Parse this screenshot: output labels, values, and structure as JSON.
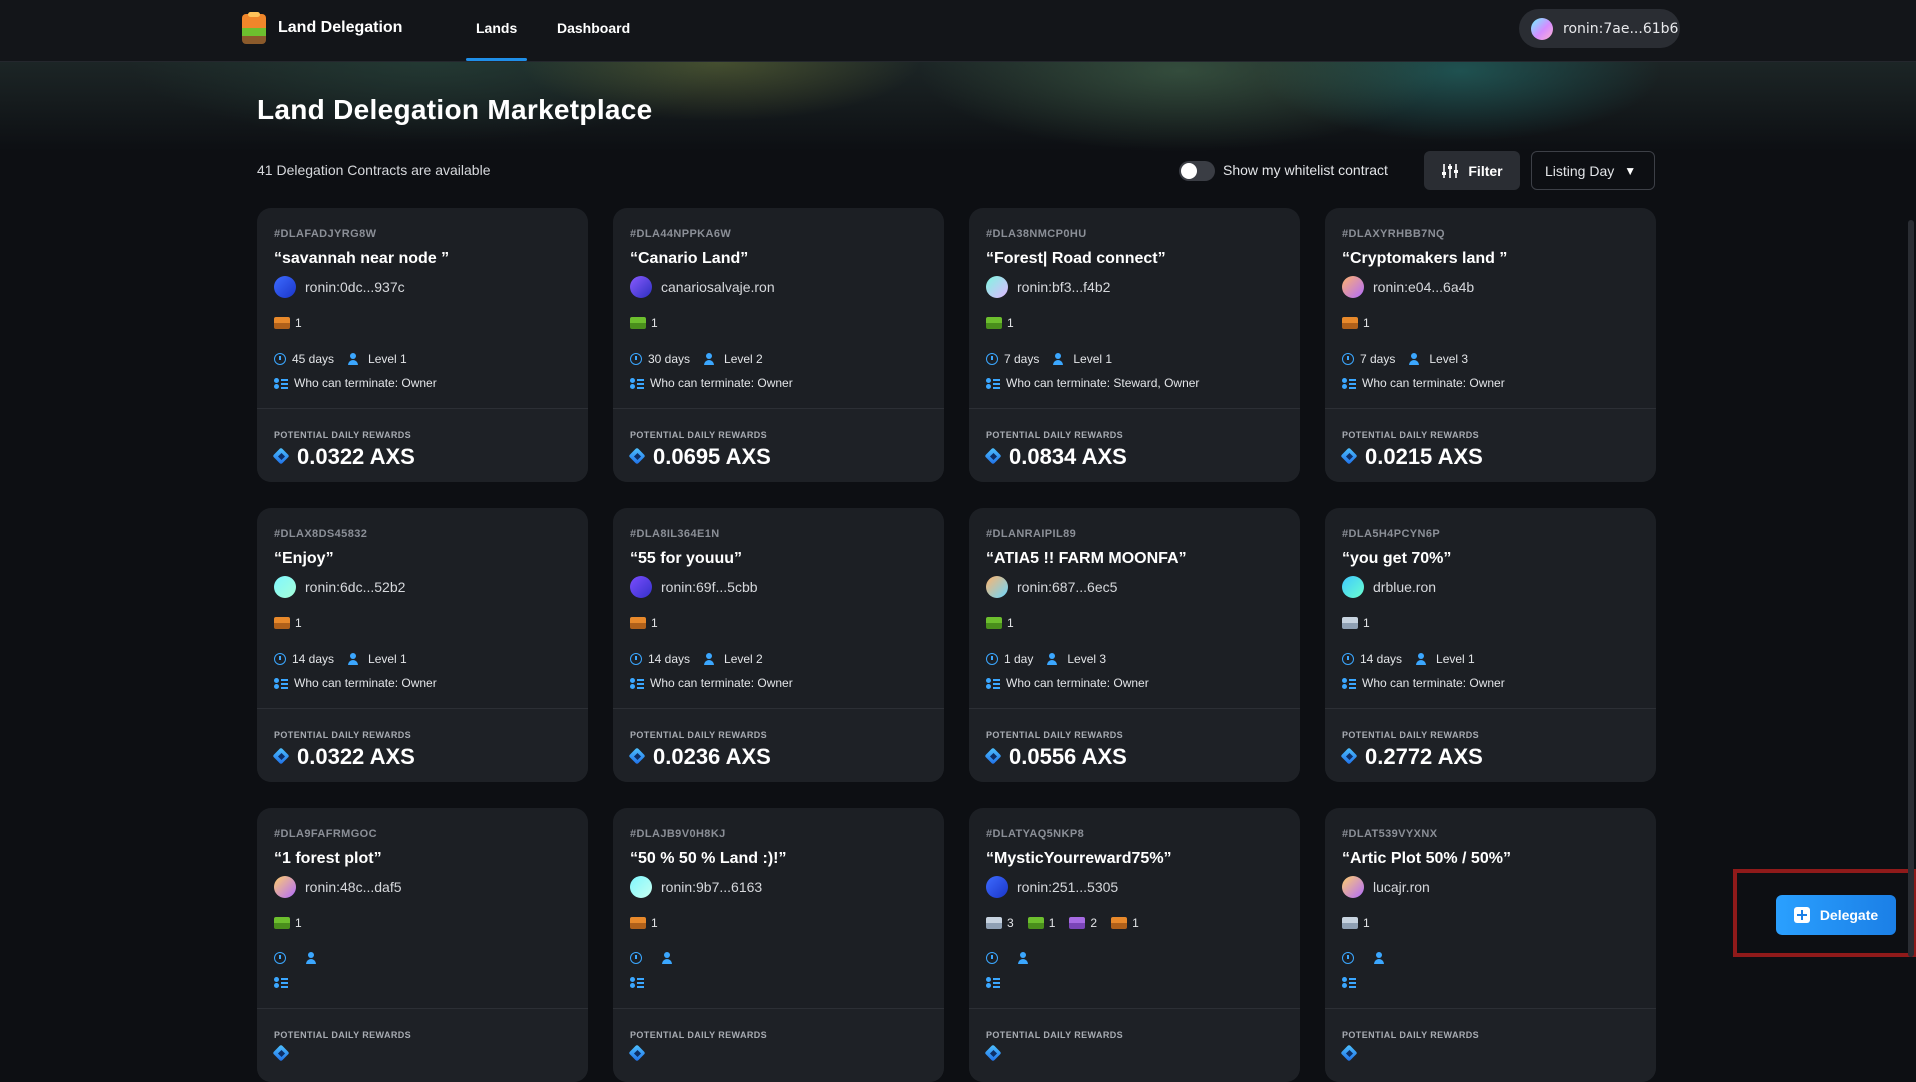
{
  "nav": {
    "brand": "Land Delegation",
    "tabs": [
      {
        "label": "Lands",
        "active": true
      },
      {
        "label": "Dashboard",
        "active": false
      }
    ],
    "wallet_address": "ronin:7ae...61b6"
  },
  "page": {
    "title": "Land Delegation Marketplace",
    "available_text": "41 Delegation Contracts are available"
  },
  "toolbar": {
    "whitelist_toggle_label": "Show my whitelist contract",
    "whitelist_toggle_on": false,
    "filter_label": "Filter",
    "sort_label": "Listing Day"
  },
  "reward_label": "POTENTIAL DAILY REWARDS",
  "terminate_prefix": "Who can terminate: ",
  "colors": {
    "accent": "#1f8fe8",
    "savannah": "#e8892b",
    "forest": "#6dbf2e",
    "arctic": "#c7d3e0",
    "mystic": "#a76be3"
  },
  "cards": [
    {
      "id": "#DLAFADJYRG8W",
      "name": "“savannah near node ”",
      "owner": "ronin:0dc...937c",
      "avatar": [
        "#3d6bff",
        "#1a35c9"
      ],
      "plots": [
        {
          "type": "savannah",
          "count": "1"
        }
      ],
      "duration": "45 days",
      "level": "Level 1",
      "terminate": "Who can terminate: Owner",
      "reward": "0.0322 AXS"
    },
    {
      "id": "#DLA44NPPKA6W",
      "name": "“Canario Land”",
      "owner": "canariosalvaje.ron",
      "avatar": [
        "#8a5bff",
        "#2c2fbf"
      ],
      "plots": [
        {
          "type": "forest",
          "count": "1"
        }
      ],
      "duration": "30 days",
      "level": "Level 2",
      "terminate": "Who can terminate: Owner",
      "reward": "0.0695 AXS"
    },
    {
      "id": "#DLA38NMCP0HU",
      "name": "“Forest| Road connect”",
      "owner": "ronin:bf3...f4b2",
      "avatar": [
        "#7ff7e0",
        "#e0b6ff"
      ],
      "plots": [
        {
          "type": "forest",
          "count": "1"
        }
      ],
      "duration": "7 days",
      "level": "Level 1",
      "terminate": "Who can terminate: Steward, Owner",
      "reward": "0.0834 AXS"
    },
    {
      "id": "#DLAXYRHBB7NQ",
      "name": "“Cryptomakers land ”",
      "owner": "ronin:e04...6a4b",
      "avatar": [
        "#ffb36b",
        "#b06bff"
      ],
      "plots": [
        {
          "type": "savannah",
          "count": "1"
        }
      ],
      "duration": "7 days",
      "level": "Level 3",
      "terminate": "Who can terminate: Owner",
      "reward": "0.0215 AXS"
    },
    {
      "id": "#DLAX8DS45832",
      "name": "“Enjoy”",
      "owner": "ronin:6dc...52b2",
      "avatar": [
        "#7ff7ff",
        "#a7ffd8"
      ],
      "plots": [
        {
          "type": "savannah",
          "count": "1"
        }
      ],
      "duration": "14 days",
      "level": "Level 1",
      "terminate": "Who can terminate: Owner",
      "reward": "0.0322 AXS"
    },
    {
      "id": "#DLA8IL364E1N",
      "name": "“55 for youuu”",
      "owner": "ronin:69f...5cbb",
      "avatar": [
        "#7b4dff",
        "#3431c9"
      ],
      "plots": [
        {
          "type": "savannah",
          "count": "1"
        }
      ],
      "duration": "14 days",
      "level": "Level 2",
      "terminate": "Who can terminate: Owner",
      "reward": "0.0236 AXS"
    },
    {
      "id": "#DLANRAIPIL89",
      "name": "“ATIA5 !! FARM MOONFA”",
      "owner": "ronin:687...6ec5",
      "avatar": [
        "#ffb36b",
        "#6bd7ff"
      ],
      "plots": [
        {
          "type": "forest",
          "count": "1"
        }
      ],
      "duration": "1 day",
      "level": "Level 3",
      "terminate": "Who can terminate: Owner",
      "reward": "0.0556 AXS"
    },
    {
      "id": "#DLA5H4PCYN6P",
      "name": "“you get 70%”",
      "owner": "drblue.ron",
      "avatar": [
        "#3fc9ff",
        "#6bffcf"
      ],
      "plots": [
        {
          "type": "arctic",
          "count": "1"
        }
      ],
      "duration": "14 days",
      "level": "Level 1",
      "terminate": "Who can terminate: Owner",
      "reward": "0.2772 AXS"
    },
    {
      "id": "#DLA9FAFRMGOC",
      "name": "“1 forest plot”",
      "owner": "ronin:48c...daf5",
      "avatar": [
        "#ffcf6b",
        "#b06bff"
      ],
      "plots": [
        {
          "type": "forest",
          "count": "1"
        }
      ],
      "duration": "",
      "level": "",
      "terminate": "",
      "reward": ""
    },
    {
      "id": "#DLAJB9V0H8KJ",
      "name": "“50 % 50 % Land :)!”",
      "owner": "ronin:9b7...6163",
      "avatar": [
        "#7ff7ff",
        "#c8fff0"
      ],
      "plots": [
        {
          "type": "savannah",
          "count": "1"
        }
      ],
      "duration": "",
      "level": "",
      "terminate": "",
      "reward": ""
    },
    {
      "id": "#DLATYAQ5NKP8",
      "name": "“MysticYourreward75%”",
      "owner": "ronin:251...5305",
      "avatar": [
        "#3d6bff",
        "#1a35c9"
      ],
      "plots": [
        {
          "type": "arctic",
          "count": "3"
        },
        {
          "type": "forest",
          "count": "1"
        },
        {
          "type": "mystic",
          "count": "2"
        },
        {
          "type": "savannah",
          "count": "1"
        }
      ],
      "duration": "",
      "level": "",
      "terminate": "",
      "reward": ""
    },
    {
      "id": "#DLAT539VYXNX",
      "name": "“Artic Plot 50% / 50%”",
      "owner": "lucajr.ron",
      "avatar": [
        "#ffcf6b",
        "#b06bff"
      ],
      "plots": [
        {
          "type": "arctic",
          "count": "1"
        }
      ],
      "duration": "",
      "level": "",
      "terminate": "",
      "reward": ""
    }
  ],
  "delegate_button": "Delegate"
}
